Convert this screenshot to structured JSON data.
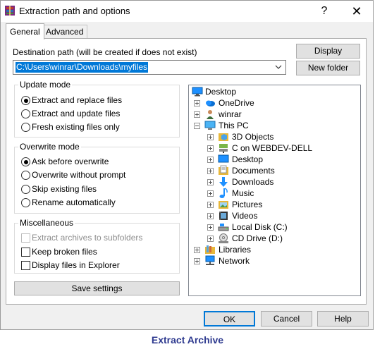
{
  "window": {
    "title": "Extraction path and options",
    "help_glyph": "?",
    "close_glyph": "✕"
  },
  "tabs": [
    {
      "label": "General",
      "active": true
    },
    {
      "label": "Advanced",
      "active": false
    }
  ],
  "destination": {
    "label": "Destination path (will be created if does not exist)",
    "value": "C:\\Users\\winrar\\Downloads\\myfiles",
    "display_button": "Display",
    "new_folder_button": "New folder"
  },
  "update_mode": {
    "title": "Update mode",
    "options": [
      {
        "label": "Extract and replace files",
        "selected": true
      },
      {
        "label": "Extract and update files",
        "selected": false
      },
      {
        "label": "Fresh existing files only",
        "selected": false
      }
    ]
  },
  "overwrite_mode": {
    "title": "Overwrite mode",
    "options": [
      {
        "label": "Ask before overwrite",
        "selected": true
      },
      {
        "label": "Overwrite without prompt",
        "selected": false
      },
      {
        "label": "Skip existing files",
        "selected": false
      },
      {
        "label": "Rename automatically",
        "selected": false
      }
    ]
  },
  "misc": {
    "title": "Miscellaneous",
    "options": [
      {
        "label": "Extract archives to subfolders",
        "checked": false,
        "disabled": true
      },
      {
        "label": "Keep broken files",
        "checked": false,
        "disabled": false
      },
      {
        "label": "Display files in Explorer",
        "checked": false,
        "disabled": false
      }
    ]
  },
  "save_settings": "Save settings",
  "tree": [
    {
      "label": "Desktop",
      "icon": "desktop-icon",
      "expander": "none"
    },
    {
      "label": "OneDrive",
      "icon": "onedrive-icon",
      "expander": "plus"
    },
    {
      "label": "winrar",
      "icon": "user-icon",
      "expander": "plus"
    },
    {
      "label": "This PC",
      "icon": "pc-icon",
      "expander": "minus"
    },
    {
      "label": "3D Objects",
      "icon": "3d-objects-icon",
      "expander": "plus"
    },
    {
      "label": "C on WEBDEV-DELL",
      "icon": "network-drive-icon",
      "expander": "plus"
    },
    {
      "label": "Desktop",
      "icon": "desktop-icon",
      "expander": "plus"
    },
    {
      "label": "Documents",
      "icon": "documents-icon",
      "expander": "plus"
    },
    {
      "label": "Downloads",
      "icon": "downloads-icon",
      "expander": "plus"
    },
    {
      "label": "Music",
      "icon": "music-icon",
      "expander": "plus"
    },
    {
      "label": "Pictures",
      "icon": "pictures-icon",
      "expander": "plus"
    },
    {
      "label": "Videos",
      "icon": "videos-icon",
      "expander": "plus"
    },
    {
      "label": "Local Disk (C:)",
      "icon": "local-disk-icon",
      "expander": "plus"
    },
    {
      "label": "CD Drive (D:)",
      "icon": "cd-drive-icon",
      "expander": "plus"
    },
    {
      "label": "Libraries",
      "icon": "libraries-icon",
      "expander": "plus"
    },
    {
      "label": "Network",
      "icon": "network-icon",
      "expander": "plus"
    }
  ],
  "buttons": {
    "ok": "OK",
    "cancel": "Cancel",
    "help": "Help"
  },
  "caption": "Extract Archive",
  "colors": {
    "selection": "#0078d7",
    "caption": "#2e3a8f",
    "folder": "#e8b83a",
    "accent": "#1e90ff"
  }
}
